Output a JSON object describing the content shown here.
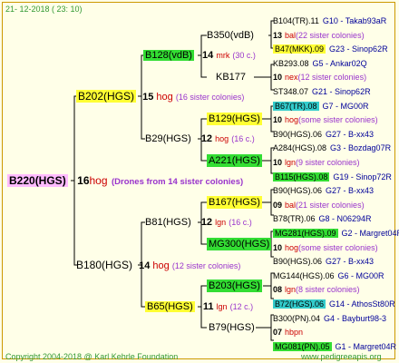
{
  "date": "21- 12-2018 ( 23: 10)",
  "copyright": "Copyright 2004-2018 @ Karl Kehrle Foundation",
  "website": "www.pedigreeapis.org",
  "root": {
    "name": "B220(HGS)",
    "count": "16",
    "unit": "hog",
    "note": "(Drones from 14 sister colonies)"
  },
  "g1": [
    {
      "name": "B202(HGS)",
      "count": "15",
      "unit": "hog",
      "note": "(16 sister colonies)"
    },
    {
      "name": "B180(HGS)",
      "count": "14",
      "unit": "hog",
      "note": "(12 sister colonies)"
    }
  ],
  "g2": [
    {
      "name": "B128(vdB)",
      "count": "14",
      "unit": "mrk",
      "note": "(30 c.)"
    },
    {
      "name": "B29(HGS)",
      "count": "12",
      "unit": "hog",
      "note": "(16 c.)"
    },
    {
      "name": "B81(HGS)",
      "count": "12",
      "unit": "lgn",
      "note": "(16 c.)"
    },
    {
      "name": "B65(HGS)",
      "count": "11",
      "unit": "lgn",
      "note": "(12 c.)"
    }
  ],
  "g3": [
    {
      "name": "B350(vdB)"
    },
    {
      "name": "KB177"
    },
    {
      "name": "B129(HGS)"
    },
    {
      "name": "A221(HGS)"
    },
    {
      "name": "B167(HGS)"
    },
    {
      "name": "MG300(HGS)"
    },
    {
      "name": "B203(HGS)"
    },
    {
      "name": "B79(HGS)"
    }
  ],
  "g4": [
    {
      "left": "B104(TR).11",
      "right": "G10 - Takab93aR"
    },
    {
      "count": "13",
      "unit": "bal",
      "note": "(22 sister colonies)"
    },
    {
      "left": "B47(MKK).09",
      "right": "G23 - Sinop62R"
    },
    {
      "left": "KB293.08",
      "right": "G5 - Ankar02Q"
    },
    {
      "count": "10",
      "unit": "nex",
      "note": "(12 sister colonies)"
    },
    {
      "left": "ST348.07",
      "right": "G21 - Sinop62R"
    },
    {
      "left": "B67(TR).08",
      "right": "G7 - MG00R"
    },
    {
      "count": "10",
      "unit": "hog",
      "note": "(some sister colonies)"
    },
    {
      "left": "B90(HGS).06",
      "right": "G27 - B-xx43"
    },
    {
      "left": "A284(HGS).08",
      "right": "G3 - Bozdag07R"
    },
    {
      "count": "10",
      "unit": "lgn",
      "note": "(9 sister colonies)"
    },
    {
      "left": "B115(HGS).08",
      "right": "G19 - Sinop72R"
    },
    {
      "left": "B90(HGS).06",
      "right": "G27 - B-xx43"
    },
    {
      "count": "09",
      "unit": "bal",
      "note": "(21 sister colonies)"
    },
    {
      "left": "B78(TR).06",
      "right": "G8 - N06294R"
    },
    {
      "left": "MG281(HGS).09",
      "right": "G2 - Margret04R"
    },
    {
      "count": "10",
      "unit": "hog",
      "note": "(some sister colonies)"
    },
    {
      "left": "B90(HGS).06",
      "right": "G27 - B-xx43"
    },
    {
      "left": "MG144(HGS).06",
      "right": "G6 - MG00R"
    },
    {
      "count": "08",
      "unit": "lgn",
      "note": "(8 sister colonies)"
    },
    {
      "left": "B72(HGS).06",
      "right": "G14 - AthosSt80R"
    },
    {
      "left": "B300(PN).04",
      "right": "G4 - Bayburt98-3"
    },
    {
      "count": "07",
      "unit": "hbpn",
      "note": ""
    },
    {
      "left": "MG081(PN).05",
      "right": "G1 - Margret04R"
    }
  ]
}
